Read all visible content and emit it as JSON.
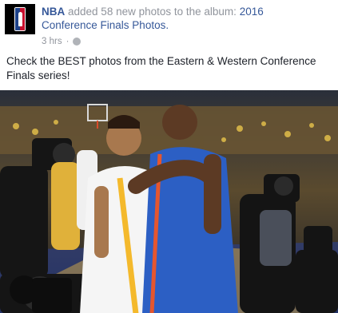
{
  "post": {
    "author": "NBA",
    "action": "added 58 new photos to the album:",
    "album_line1": "2016",
    "album_line2": "Conference Finals Photos.",
    "timestamp": "3 hrs",
    "separator": "·",
    "privacy_icon": "globe-icon",
    "message": "Check the BEST photos from the Eastern & Western Conference Finals series!"
  },
  "colors": {
    "link": "#365899",
    "meta": "#90949c",
    "warriors_yellow": "#f4b92c",
    "thunder_blue": "#2c5fc4"
  }
}
